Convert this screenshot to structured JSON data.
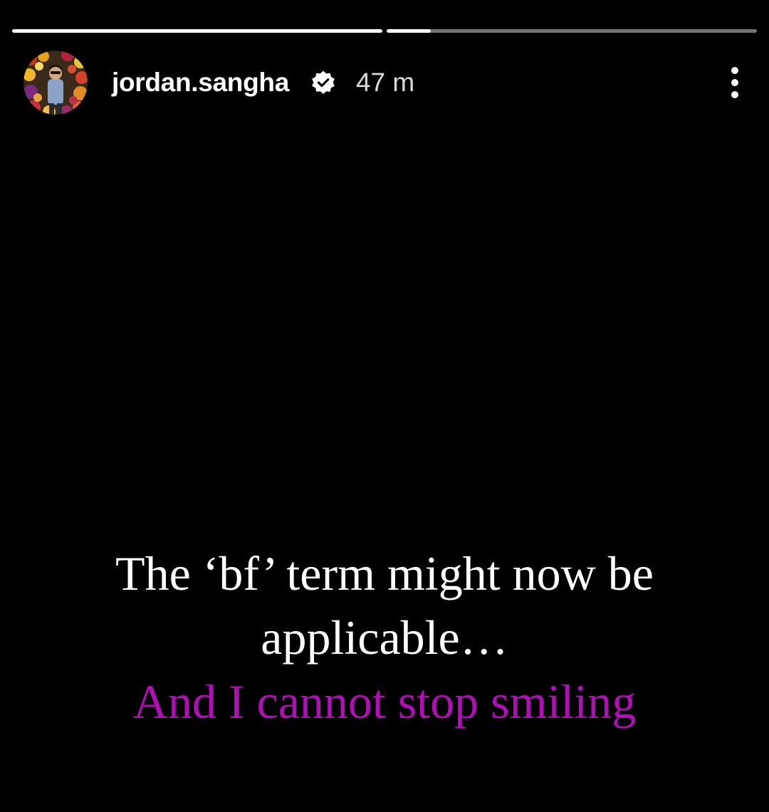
{
  "story": {
    "progress": [
      {
        "fraction": 1.0
      },
      {
        "fraction": 0.12
      }
    ]
  },
  "header": {
    "username": "jordan.sangha",
    "verified": true,
    "timestamp": "47 m",
    "more_icon": "more-vertical-icon",
    "verified_icon": "verified-badge-icon"
  },
  "caption": {
    "line1": "The ‘bf’ term might now be",
    "line2": "applicable…",
    "line3": "And I cannot stop smiling",
    "accent_color": "#b00fb5"
  },
  "colors": {
    "background": "#000000",
    "text": "#ffffff",
    "accent": "#b00fb5"
  }
}
